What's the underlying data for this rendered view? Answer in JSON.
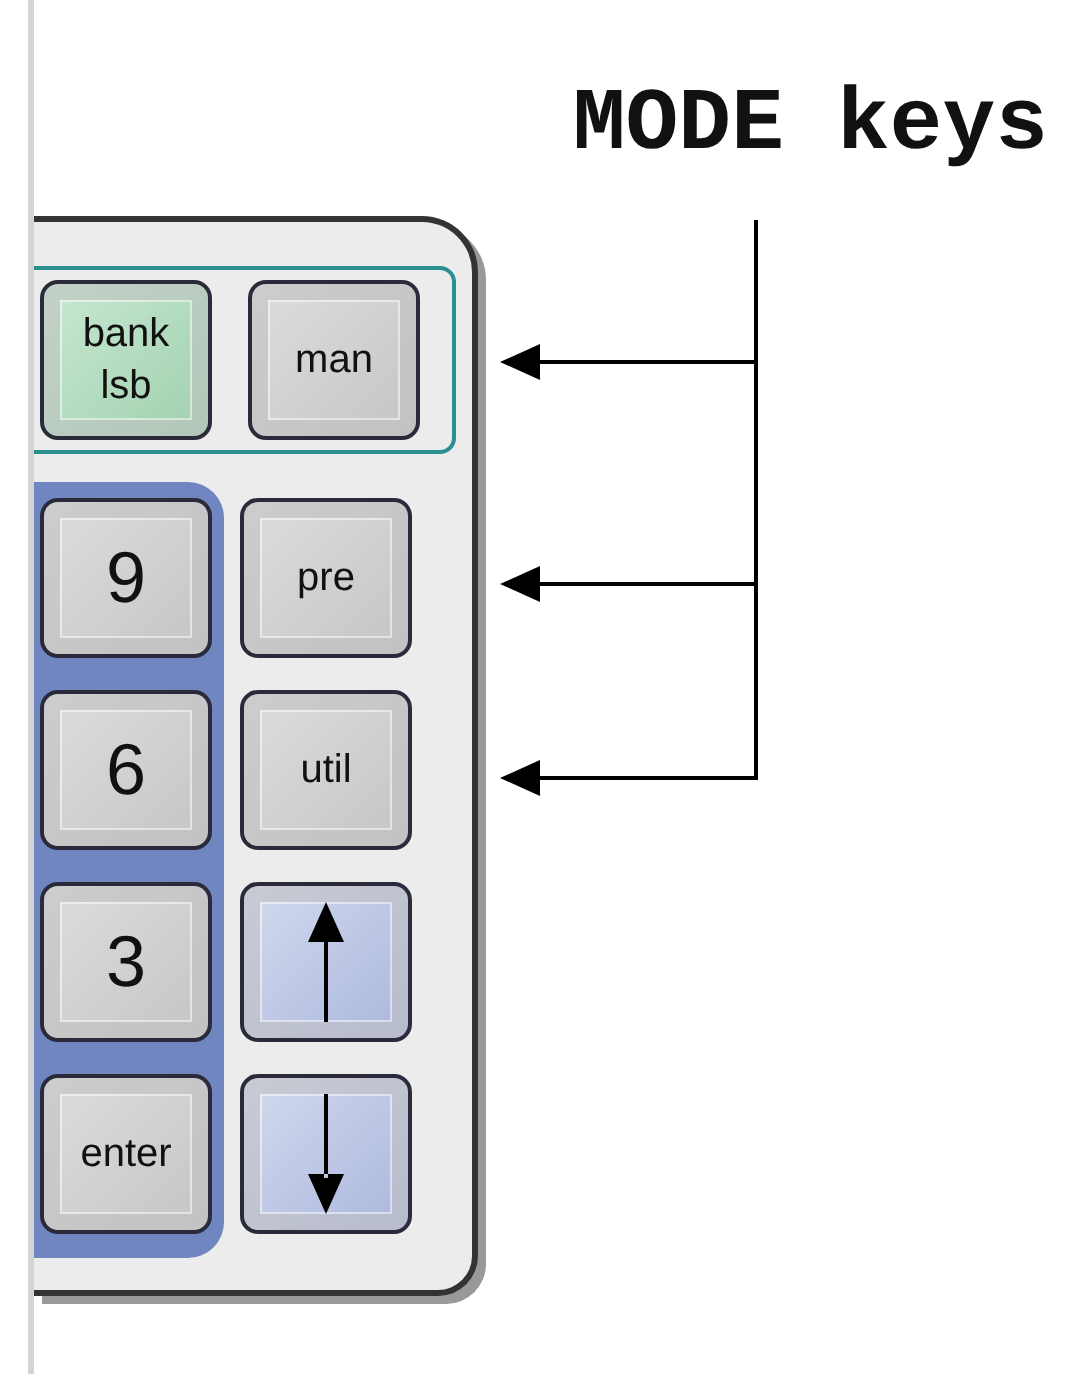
{
  "annotation": {
    "label": "MODE keys"
  },
  "keypad": {
    "left_column": [
      {
        "label": "bank\nlsb",
        "kind": "bank"
      },
      {
        "label": "9",
        "kind": "digit"
      },
      {
        "label": "6",
        "kind": "digit"
      },
      {
        "label": "3",
        "kind": "digit"
      },
      {
        "label": "enter",
        "kind": "word"
      }
    ],
    "right_column": [
      {
        "label": "man",
        "kind": "mode"
      },
      {
        "label": "pre",
        "kind": "mode"
      },
      {
        "label": "util",
        "kind": "mode"
      },
      {
        "kind": "arrow-up"
      },
      {
        "kind": "arrow-down"
      }
    ]
  }
}
